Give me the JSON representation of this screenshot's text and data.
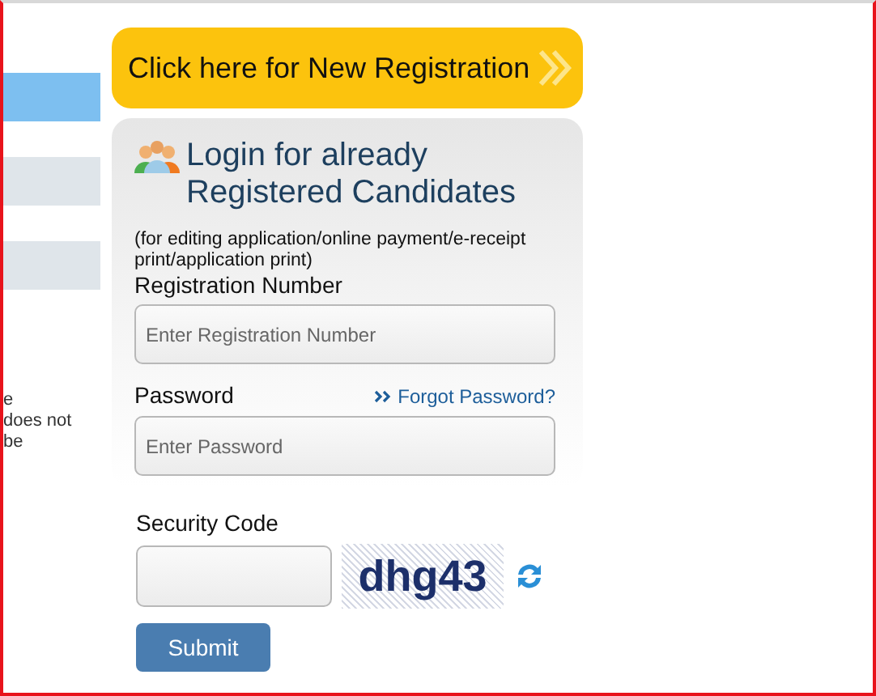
{
  "sidebar": {
    "items": [
      {
        "selected": true
      },
      {
        "selected": false
      },
      {
        "selected": false
      }
    ],
    "note_lines": [
      "e",
      "does not",
      "be"
    ]
  },
  "new_registration_button": {
    "label": "Click here for New Registration"
  },
  "login": {
    "title": "Login for already Registered Candidates",
    "note": "(for editing application/online payment/e-receipt print/application print)",
    "registration_label": "Registration Number",
    "registration_placeholder": "Enter Registration Number",
    "password_label": "Password",
    "forgot_link": "Forgot Password?",
    "password_placeholder": "Enter Password",
    "security_label": "Security Code",
    "captcha_text": "dhg43",
    "submit": "Submit"
  }
}
